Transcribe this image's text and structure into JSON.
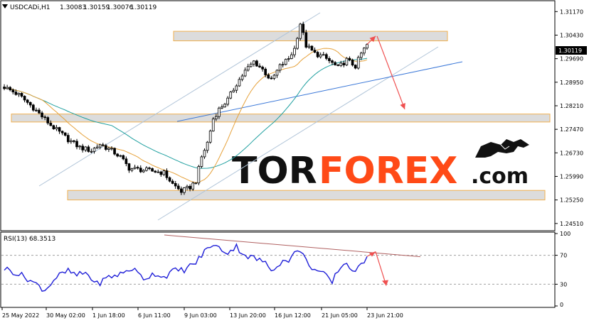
{
  "header": {
    "symbol": "USDCADi,H1",
    "open": "1.30083",
    "high": "1.30159",
    "low": "1.30076",
    "close": "1.30119"
  },
  "price_badge": "1.30119",
  "watermark": {
    "part1": "TOR",
    "part2": "FOREX",
    "part3": ".com"
  },
  "rsi_header": "RSI(13) 68.3513",
  "colors": {
    "bull": "#000000",
    "ma_slow": "#20a0a0",
    "ma_fast": "#e6a23c",
    "channel": "#b0c4d8",
    "trend": "#3b78d8",
    "zone_fill": "#dcdcdc",
    "zone_border": "#f0b050",
    "arrow": "#ef5050",
    "rsi": "#1f1fd8",
    "rsi_trend": "#b06060",
    "watermark_accent": "#ff4a17"
  },
  "chart_data": [
    {
      "type": "candlestick",
      "symbol": "USDCADi",
      "timeframe": "H1",
      "x_ticks": [
        "25 May 2022",
        "30 May 02:00",
        "1 Jun 18:00",
        "6 Jun 11:00",
        "9 Jun 03:00",
        "13 Jun 20:00",
        "16 Jun 12:00",
        "21 Jun 05:00",
        "23 Jun 21:00"
      ],
      "y_ticks": [
        "1.31170",
        "1.30430",
        "1.29690",
        "1.28950",
        "1.28210",
        "1.27470",
        "1.26730",
        "1.25990",
        "1.25250",
        "1.24510"
      ],
      "ylim": [
        1.2435,
        1.314
      ],
      "approx_close_path": [
        [
          0,
          1.288
        ],
        [
          5,
          1.2855
        ],
        [
          10,
          1.2815
        ],
        [
          16,
          1.276
        ],
        [
          22,
          1.2715
        ],
        [
          26,
          1.269
        ],
        [
          30,
          1.268
        ],
        [
          33,
          1.27
        ],
        [
          37,
          1.268
        ],
        [
          40,
          1.266
        ],
        [
          43,
          1.2625
        ],
        [
          47,
          1.262
        ],
        [
          52,
          1.2615
        ],
        [
          55,
          1.261
        ],
        [
          58,
          1.2575
        ],
        [
          61,
          1.2552
        ],
        [
          64,
          1.2565
        ],
        [
          66,
          1.2585
        ],
        [
          68,
          1.266
        ],
        [
          70,
          1.2705
        ],
        [
          72,
          1.278
        ],
        [
          74,
          1.281
        ],
        [
          77,
          1.284
        ],
        [
          80,
          1.289
        ],
        [
          83,
          1.293
        ],
        [
          86,
          1.296
        ],
        [
          89,
          1.2935
        ],
        [
          92,
          1.29
        ],
        [
          95,
          1.2945
        ],
        [
          98,
          1.297
        ],
        [
          100,
          1.3
        ],
        [
          102,
          1.308
        ],
        [
          104,
          1.301
        ],
        [
          107,
          1.2985
        ],
        [
          110,
          1.2975
        ],
        [
          113,
          1.2955
        ],
        [
          115,
          1.294
        ],
        [
          118,
          1.2965
        ],
        [
          121,
          1.2945
        ],
        [
          123,
          1.2985
        ],
        [
          125,
          1.3012
        ]
      ],
      "resistance_zone": [
        1.3025,
        1.3055
      ],
      "mid_zone": [
        1.277,
        1.2795
      ],
      "support_zone": [
        1.2525,
        1.2555
      ],
      "forecast": {
        "up_to": 1.304,
        "down_to": 1.281
      }
    },
    {
      "type": "line",
      "title": "RSI(13)",
      "last_value": 68.3513,
      "y_ticks": [
        "100",
        "70",
        "30",
        "0"
      ],
      "ylim": [
        0,
        100
      ],
      "levels": [
        70,
        30
      ],
      "approx_values": [
        [
          0,
          52
        ],
        [
          4,
          46
        ],
        [
          8,
          38
        ],
        [
          11,
          30
        ],
        [
          14,
          22
        ],
        [
          18,
          40
        ],
        [
          22,
          48
        ],
        [
          25,
          42
        ],
        [
          28,
          46
        ],
        [
          32,
          30
        ],
        [
          36,
          40
        ],
        [
          40,
          44
        ],
        [
          44,
          52
        ],
        [
          48,
          38
        ],
        [
          52,
          45
        ],
        [
          55,
          40
        ],
        [
          58,
          48
        ],
        [
          62,
          50
        ],
        [
          66,
          60
        ],
        [
          68,
          70
        ],
        [
          71,
          84
        ],
        [
          74,
          80
        ],
        [
          77,
          74
        ],
        [
          80,
          82
        ],
        [
          83,
          70
        ],
        [
          86,
          66
        ],
        [
          89,
          62
        ],
        [
          92,
          50
        ],
        [
          95,
          60
        ],
        [
          98,
          64
        ],
        [
          100,
          72
        ],
        [
          102,
          78
        ],
        [
          104,
          62
        ],
        [
          107,
          50
        ],
        [
          110,
          44
        ],
        [
          113,
          32
        ],
        [
          115,
          50
        ],
        [
          118,
          60
        ],
        [
          121,
          44
        ],
        [
          123,
          58
        ],
        [
          125,
          68
        ]
      ],
      "forecast": {
        "up_to": 75,
        "down_to": 28
      }
    }
  ]
}
